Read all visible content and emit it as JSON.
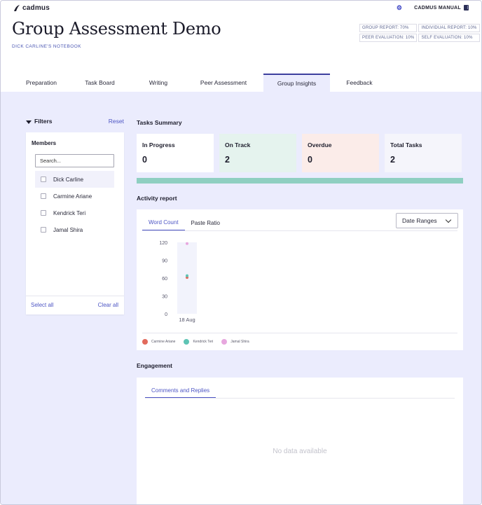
{
  "app": {
    "brand": "cadmus",
    "manual_label": "CADMUS MANUAL"
  },
  "page": {
    "title": "Group Assessment Demo",
    "notebook": "DICK CARLINE'S NOTEBOOK",
    "weights": [
      "GROUP REPORT: 70%",
      "INDIVIDUAL REPORT: 10%",
      "PEER EVALUATION: 10%",
      "SELF EVALUATION: 10%"
    ]
  },
  "tabs": [
    {
      "label": "Preparation",
      "active": false
    },
    {
      "label": "Task Board",
      "active": false
    },
    {
      "label": "Writing",
      "active": false
    },
    {
      "label": "Peer Assessment",
      "active": false
    },
    {
      "label": "Group Insights",
      "active": true
    },
    {
      "label": "Feedback",
      "active": false
    }
  ],
  "filters": {
    "title": "Filters",
    "reset_label": "Reset",
    "members_title": "Members",
    "search_placeholder": "Search...",
    "members": [
      "Dick Carline",
      "Carmine Ariane",
      "Kendrick Teri",
      "Jamal Shira"
    ],
    "select_all": "Select all",
    "clear_all": "Clear all"
  },
  "summary": {
    "title": "Tasks Summary",
    "cards": [
      {
        "label": "In Progress",
        "value": "0",
        "color": "#ffffff"
      },
      {
        "label": "On Track",
        "value": "2",
        "color": "#e5f3ee"
      },
      {
        "label": "Overdue",
        "value": "0",
        "color": "#fbece9"
      },
      {
        "label": "Total Tasks",
        "value": "2",
        "color": "#f5f5fb"
      }
    ],
    "progress_fraction": 1.0,
    "progress_color": "#8fcfc1"
  },
  "activity": {
    "title": "Activity report",
    "tabs": [
      "Word Count",
      "Paste Ratio"
    ],
    "active_tab": "Word Count",
    "range_label": "Date Ranges"
  },
  "chart_data": {
    "type": "scatter",
    "title": "",
    "xlabel": "",
    "ylabel": "",
    "categories": [
      "18 Aug"
    ],
    "yticks": [
      0,
      30,
      60,
      90,
      120
    ],
    "ylim": [
      0,
      120
    ],
    "grid": false,
    "legend_position": "bottom-left",
    "series": [
      {
        "name": "Carmine Ariane",
        "color": "#e26a5c",
        "values": [
          61
        ]
      },
      {
        "name": "Kendrick Teri",
        "color": "#5ec4b4",
        "values": [
          64
        ]
      },
      {
        "name": "Jamal Shira",
        "color": "#e7a7de",
        "values": [
          118
        ]
      }
    ]
  },
  "engagement": {
    "title": "Engagement",
    "tab_label": "Comments and Replies",
    "empty_text": "No data available"
  },
  "colors": {
    "accent": "#4d55c4",
    "background": "#ebecfd"
  }
}
